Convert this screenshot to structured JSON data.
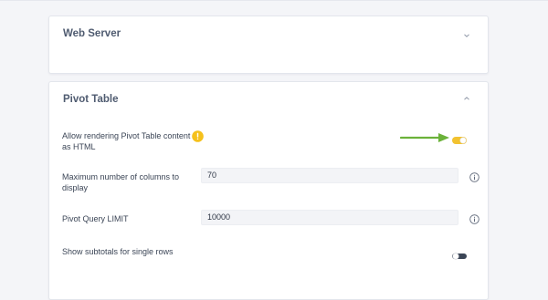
{
  "sections": {
    "web_server": {
      "title": "Web Server",
      "expanded": false
    },
    "pivot_table": {
      "title": "Pivot Table",
      "expanded": true
    }
  },
  "settings": {
    "allow_html": {
      "label_line1": "Allow rendering Pivot Table content",
      "label_line2": "as HTML",
      "enabled": true,
      "warning_icon": "exclamation-circle-icon"
    },
    "max_columns": {
      "label_line1": "Maximum number of columns to",
      "label_line2": "display",
      "value": "70",
      "info_icon": "info-circle-icon"
    },
    "query_limit": {
      "label": "Pivot Query LIMIT",
      "value": "10000",
      "info_icon": "info-circle-icon"
    },
    "subtotals": {
      "label": "Show subtotals for single rows",
      "enabled": false
    }
  },
  "colors": {
    "toggle_on": "#f2c230",
    "toggle_off": "#3b4556",
    "warning": "#f5c11c",
    "arrow": "#6bb23a"
  }
}
